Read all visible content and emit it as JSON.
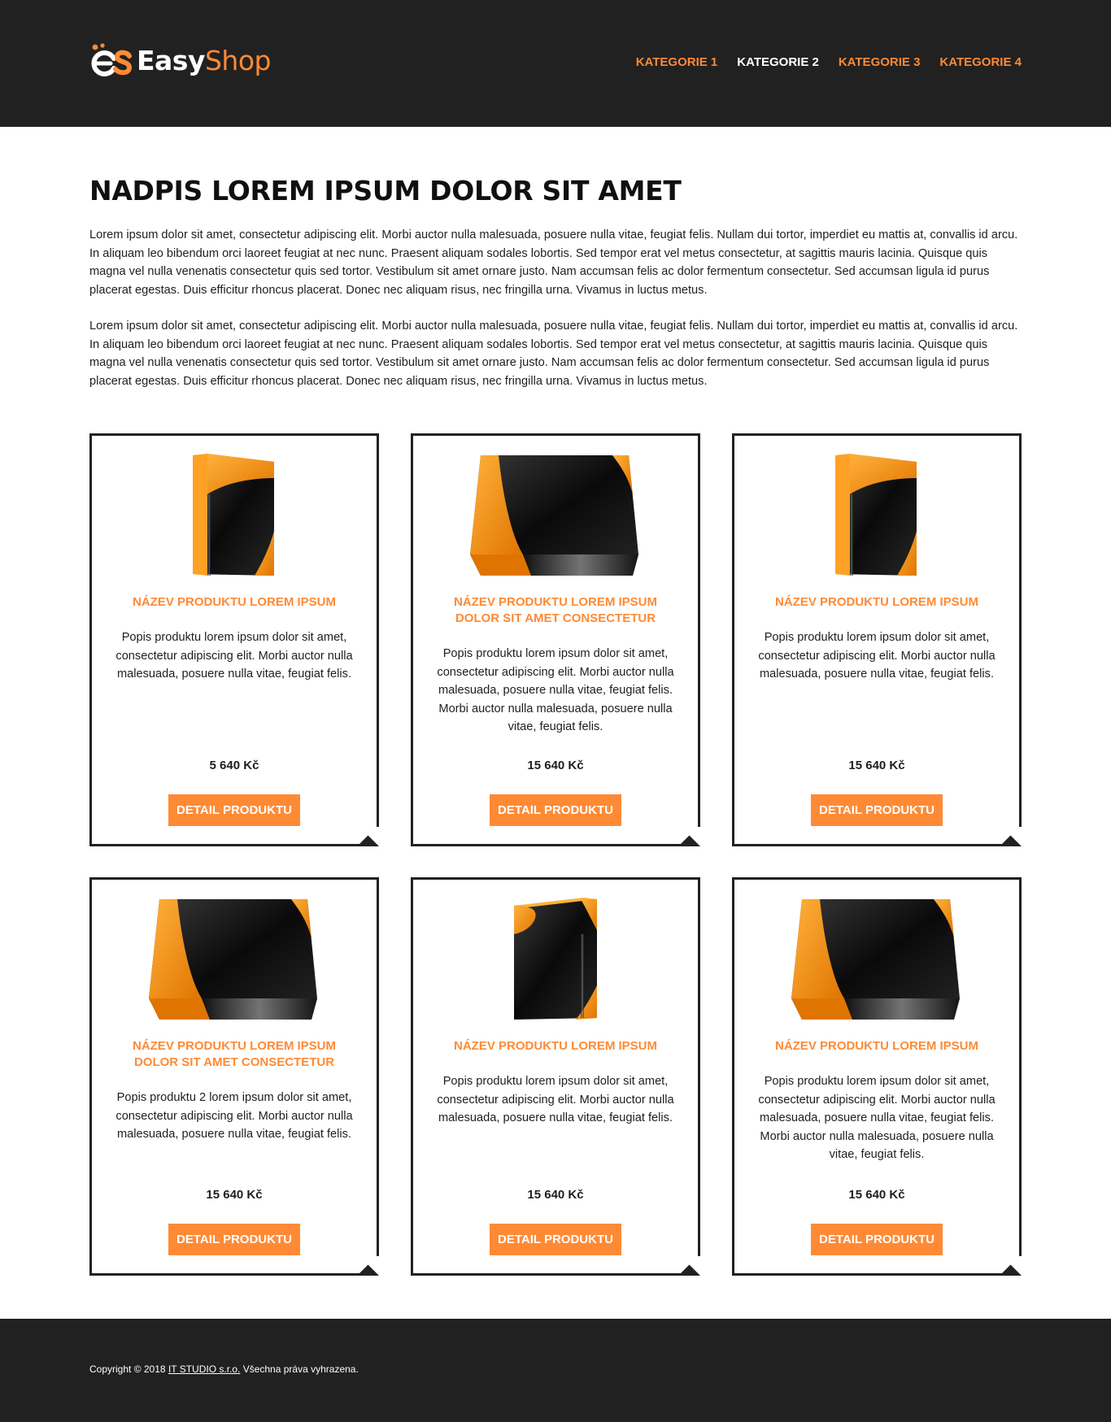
{
  "header": {
    "logo": {
      "text_easy": "Easy",
      "text_shop": "Shop"
    },
    "nav": [
      {
        "label": "KATEGORIE 1",
        "active": false
      },
      {
        "label": "KATEGORIE 2",
        "active": true
      },
      {
        "label": "KATEGORIE 3",
        "active": false
      },
      {
        "label": "KATEGORIE 4",
        "active": false
      }
    ]
  },
  "main": {
    "title": "NADPIS LOREM IPSUM DOLOR SIT AMET",
    "paragraphs": [
      "Lorem ipsum dolor sit amet, consectetur adipiscing elit. Morbi auctor nulla malesuada, posuere nulla vitae, feugiat felis. Nullam dui tortor, imperdiet eu mattis at, convallis id arcu. In aliquam leo bibendum orci laoreet feugiat at nec nunc. Praesent aliquam sodales lobortis. Sed tempor erat vel metus consectetur, at sagittis mauris lacinia. Quisque quis magna vel nulla venenatis consectetur quis sed tortor. Vestibulum sit amet ornare justo. Nam accumsan felis ac dolor fermentum consectetur. Sed accumsan ligula id purus placerat egestas. Duis efficitur rhoncus placerat. Donec nec aliquam risus, nec fringilla urna. Vivamus in luctus metus.",
      "Lorem ipsum dolor sit amet, consectetur adipiscing elit. Morbi auctor nulla malesuada, posuere nulla vitae, feugiat felis. Nullam dui tortor, imperdiet eu mattis at, convallis id arcu. In aliquam leo bibendum orci laoreet feugiat at nec nunc. Praesent aliquam sodales lobortis. Sed tempor erat vel metus consectetur, at sagittis mauris lacinia. Quisque quis magna vel nulla venenatis consectetur quis sed tortor. Vestibulum sit amet ornare justo. Nam accumsan felis ac dolor fermentum consectetur. Sed accumsan ligula id purus placerat egestas. Duis efficitur rhoncus placerat. Donec nec aliquam risus, nec fringilla urna. Vivamus in luctus metus."
    ]
  },
  "products": [
    {
      "image": "tall-box-icon",
      "title": "NÁZEV PRODUKTU LOREM IPSUM",
      "description": "Popis produktu lorem ipsum dolor sit amet, consectetur adipiscing elit. Morbi auctor nulla malesuada, posuere nulla vitae, feugiat felis.",
      "price": "5 640 Kč",
      "button": "DETAIL PRODUKTU"
    },
    {
      "image": "wide-box-icon",
      "title": "NÁZEV PRODUKTU LOREM IPSUM DOLOR SIT AMET CONSECTETUR",
      "description": "Popis produktu lorem ipsum dolor sit amet, consectetur adipiscing elit. Morbi auctor nulla malesuada, posuere nulla vitae, feugiat felis. Morbi auctor nulla malesuada, posuere nulla vitae, feugiat felis.",
      "price": "15 640 Kč",
      "button": "DETAIL PRODUKTU"
    },
    {
      "image": "tall-box-icon",
      "title": "NÁZEV PRODUKTU LOREM IPSUM",
      "description": "Popis produktu lorem ipsum dolor sit amet, consectetur adipiscing elit. Morbi auctor nulla malesuada, posuere nulla vitae, feugiat felis.",
      "price": "15 640 Kč",
      "button": "DETAIL PRODUKTU"
    },
    {
      "image": "wide-box-icon",
      "title": "NÁZEV PRODUKTU LOREM IPSUM DOLOR SIT AMET CONSECTETUR",
      "description": "Popis produktu 2 lorem ipsum dolor sit amet, consectetur adipiscing elit. Morbi auctor nulla malesuada, posuere nulla vitae, feugiat felis.",
      "price": "15 640 Kč",
      "button": "DETAIL PRODUKTU"
    },
    {
      "image": "tall-box-icon",
      "title": "NÁZEV PRODUKTU LOREM IPSUM",
      "description": "Popis produktu lorem ipsum dolor sit amet, consectetur adipiscing elit. Morbi auctor nulla malesuada, posuere nulla vitae, feugiat felis.",
      "price": "15 640 Kč",
      "button": "DETAIL PRODUKTU"
    },
    {
      "image": "wide-box-icon",
      "title": "NÁZEV PRODUKTU LOREM IPSUM",
      "description": "Popis produktu lorem ipsum dolor sit amet, consectetur adipiscing elit. Morbi auctor nulla malesuada, posuere nulla vitae, feugiat felis. Morbi auctor nulla malesuada, posuere nulla vitae, feugiat felis.",
      "price": "15 640 Kč",
      "button": "DETAIL PRODUKTU"
    }
  ],
  "footer": {
    "copyright_prefix": "Copyright © 2018 ",
    "company_link": "IT STUDIO s.r.o.",
    "copyright_suffix": " Všechna práva vyhrazena."
  },
  "colors": {
    "accent": "#ff8a35",
    "dark": "#212121",
    "text": "#1e1e1e",
    "white": "#ffffff"
  }
}
